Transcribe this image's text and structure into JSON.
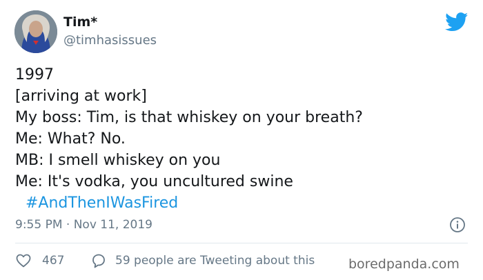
{
  "author": {
    "name": "Tim*",
    "handle": "@timhasissues",
    "avatar_icon": "profile-photo"
  },
  "brand": {
    "icon": "twitter-bird-icon",
    "color": "#1da1f2"
  },
  "tweet": {
    "lines": [
      "1997",
      "[arriving at work]",
      "My boss: Tim, is that whiskey on your breath?",
      "Me: What? No.",
      "MB: I smell whiskey on you",
      "Me: It's vodka, you uncultured swine"
    ],
    "hashtag": "#AndThenIWasFired",
    "hashtag_color": "#1b95e0"
  },
  "meta": {
    "timestamp": "9:55 PM · Nov 11, 2019",
    "info_icon": "info-icon"
  },
  "engagement": {
    "likes": "467",
    "talking": "59 people are Tweeting about this"
  },
  "watermark": "boredpanda.com"
}
